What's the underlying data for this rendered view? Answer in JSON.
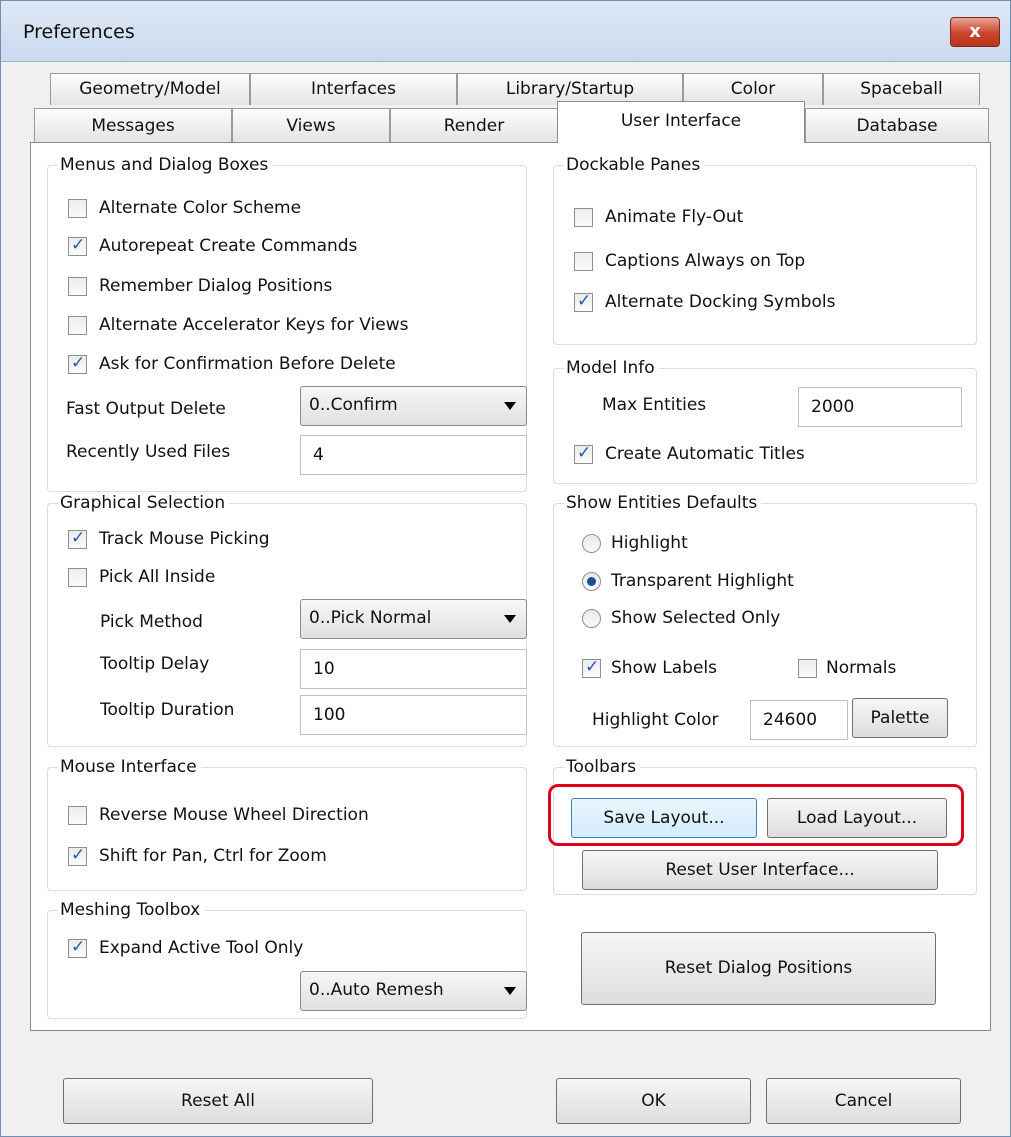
{
  "window": {
    "title": "Preferences",
    "close_glyph": "x"
  },
  "tabs": {
    "row1": [
      "Geometry/Model",
      "Interfaces",
      "Library/Startup",
      "Color",
      "Spaceball"
    ],
    "row2": [
      "Messages",
      "Views",
      "Render",
      "User Interface",
      "Database"
    ],
    "active": "User Interface"
  },
  "menus": {
    "title": "Menus and Dialog Boxes",
    "items": [
      {
        "label": "Alternate Color Scheme",
        "checked": false
      },
      {
        "label": "Autorepeat Create Commands",
        "checked": true
      },
      {
        "label": "Remember Dialog Positions",
        "checked": false
      },
      {
        "label": "Alternate Accelerator Keys for Views",
        "checked": false
      },
      {
        "label": "Ask for Confirmation Before Delete",
        "checked": true
      }
    ],
    "fast_output_label": "Fast Output Delete",
    "fast_output_value": "0..Confirm",
    "recent_label": "Recently Used Files",
    "recent_value": "4"
  },
  "dockable": {
    "title": "Dockable Panes",
    "items": [
      {
        "label": "Animate Fly-Out",
        "checked": false
      },
      {
        "label": "Captions Always on Top",
        "checked": false
      },
      {
        "label": "Alternate Docking Symbols",
        "checked": true
      }
    ]
  },
  "model_info": {
    "title": "Model Info",
    "max_label": "Max Entities",
    "max_value": "2000",
    "auto_titles_label": "Create Automatic Titles",
    "auto_titles_checked": true
  },
  "graphical": {
    "title": "Graphical Selection",
    "track_label": "Track Mouse Picking",
    "track_checked": true,
    "pick_all_label": "Pick All Inside",
    "pick_all_checked": false,
    "pick_method_label": "Pick Method",
    "pick_method_value": "0..Pick Normal",
    "delay_label": "Tooltip Delay",
    "delay_value": "10",
    "duration_label": "Tooltip Duration",
    "duration_value": "100"
  },
  "show_entities": {
    "title": "Show Entities Defaults",
    "radios": [
      {
        "label": "Highlight",
        "selected": false
      },
      {
        "label": "Transparent Highlight",
        "selected": true
      },
      {
        "label": "Show Selected Only",
        "selected": false
      }
    ],
    "labels_label": "Show Labels",
    "labels_checked": true,
    "normals_label": "Normals",
    "normals_checked": false,
    "color_label": "Highlight Color",
    "color_value": "24600",
    "palette_label": "Palette"
  },
  "mouse": {
    "title": "Mouse Interface",
    "items": [
      {
        "label": "Reverse Mouse Wheel Direction",
        "checked": false
      },
      {
        "label": "Shift for Pan, Ctrl for Zoom",
        "checked": true
      }
    ]
  },
  "toolbars": {
    "title": "Toolbars",
    "save_label": "Save Layout...",
    "load_label": "Load Layout...",
    "reset_ui_label": "Reset User Interface..."
  },
  "meshing": {
    "title": "Meshing Toolbox",
    "expand_label": "Expand Active Tool Only",
    "expand_checked": true,
    "remesh_value": "0..Auto Remesh"
  },
  "reset_dialog_label": "Reset Dialog Positions",
  "footer": {
    "reset_all": "Reset All",
    "ok": "OK",
    "cancel": "Cancel"
  }
}
